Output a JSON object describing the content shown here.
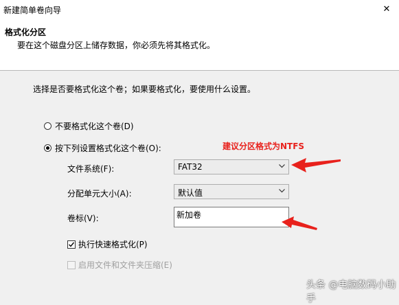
{
  "window": {
    "title": "新建简单卷向导",
    "close_glyph": "✕"
  },
  "header": {
    "title": "格式化分区",
    "subtitle": "要在这个磁盘分区上储存数据，你必须先将其格式化。"
  },
  "instruction": "选择是否要格式化这个卷；如果要格式化，要使用什么设置。",
  "options": {
    "no_format": {
      "label": "不要格式化这个卷(D)",
      "checked": false
    },
    "format": {
      "label": "按下列设置格式化这个卷(O):",
      "checked": true
    }
  },
  "fields": {
    "file_system": {
      "label": "文件系统(F):",
      "value": "FAT32"
    },
    "allocation_unit": {
      "label": "分配单元大小(A):",
      "value": "默认值"
    },
    "volume_label": {
      "label": "卷标(V):",
      "value": "新加卷"
    }
  },
  "checkboxes": {
    "quick_format": {
      "label": "执行快速格式化(P)",
      "checked": true,
      "enabled": true
    },
    "compression": {
      "label": "启用文件和文件夹压缩(E)",
      "checked": false,
      "enabled": false
    }
  },
  "annotation": {
    "text": "建议分区格式为NTFS",
    "color": "#e8211c"
  },
  "watermark": "头条 @电脑数码小助手"
}
